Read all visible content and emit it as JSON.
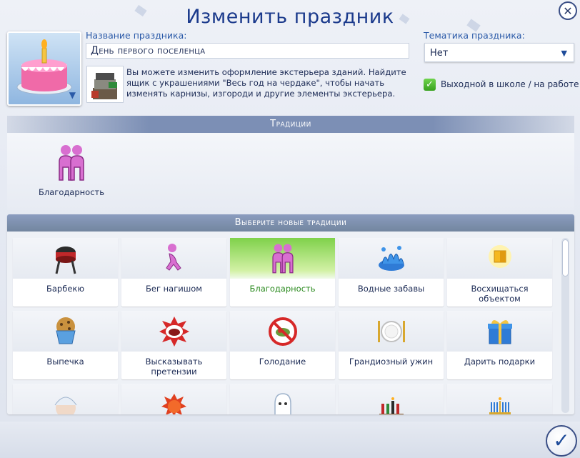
{
  "dialog": {
    "title": "Изменить праздник",
    "close_icon": "close-icon",
    "confirm_icon": "checkmark-icon"
  },
  "holiday": {
    "name_label": "Название праздника:",
    "name_value": "День первого поселенца",
    "icon": "birthday-cake-icon",
    "info_icon": "decoration-crates-icon",
    "info_text": "Вы можете изменить оформление экстерьера зданий. Найдите ящик с украшениями \"Весь год на чердаке\", чтобы начать изменять карнизы, изгороди и другие элементы экстерьера.",
    "theme_label": "Тематика праздника:",
    "theme_value": "Нет",
    "day_off_label": "Выходной в школе / на работе",
    "day_off_checked": true
  },
  "traditions": {
    "header": "Традиции",
    "items": [
      {
        "label": "Благодарность",
        "icon": "gratitude-icon"
      }
    ]
  },
  "new_traditions": {
    "header": "Выберите новые традиции",
    "items": [
      {
        "label": "Барбекю",
        "icon": "grill-icon",
        "selected": false
      },
      {
        "label": "Бег нагишом",
        "icon": "streaking-icon",
        "selected": false
      },
      {
        "label": "Благодарность",
        "icon": "gratitude-icon",
        "selected": true
      },
      {
        "label": "Водные забавы",
        "icon": "water-splash-icon",
        "selected": false
      },
      {
        "label": "Восхищаться объектом",
        "icon": "admire-object-icon",
        "selected": false
      },
      {
        "label": "Выпечка",
        "icon": "muffin-icon",
        "selected": false
      },
      {
        "label": "Высказывать претензии",
        "icon": "complaining-mouth-icon",
        "selected": false
      },
      {
        "label": "Голодание",
        "icon": "fasting-icon",
        "selected": false
      },
      {
        "label": "Грандиозный ужин",
        "icon": "dinner-plate-icon",
        "selected": false
      },
      {
        "label": "Дарить подарки",
        "icon": "gift-icon",
        "selected": false
      },
      {
        "label": "",
        "icon": "winter-face-icon",
        "selected": false
      },
      {
        "label": "",
        "icon": "sun-face-icon",
        "selected": false
      },
      {
        "label": "",
        "icon": "ghost-icon",
        "selected": false
      },
      {
        "label": "",
        "icon": "kwanzaa-candles-icon",
        "selected": false
      },
      {
        "label": "",
        "icon": "menorah-icon",
        "selected": false
      }
    ]
  },
  "colors": {
    "title": "#1b3a8c",
    "accent_blue": "#2a5aa8",
    "selected_green": "#7fd14a",
    "band": "#7c8fb5"
  }
}
